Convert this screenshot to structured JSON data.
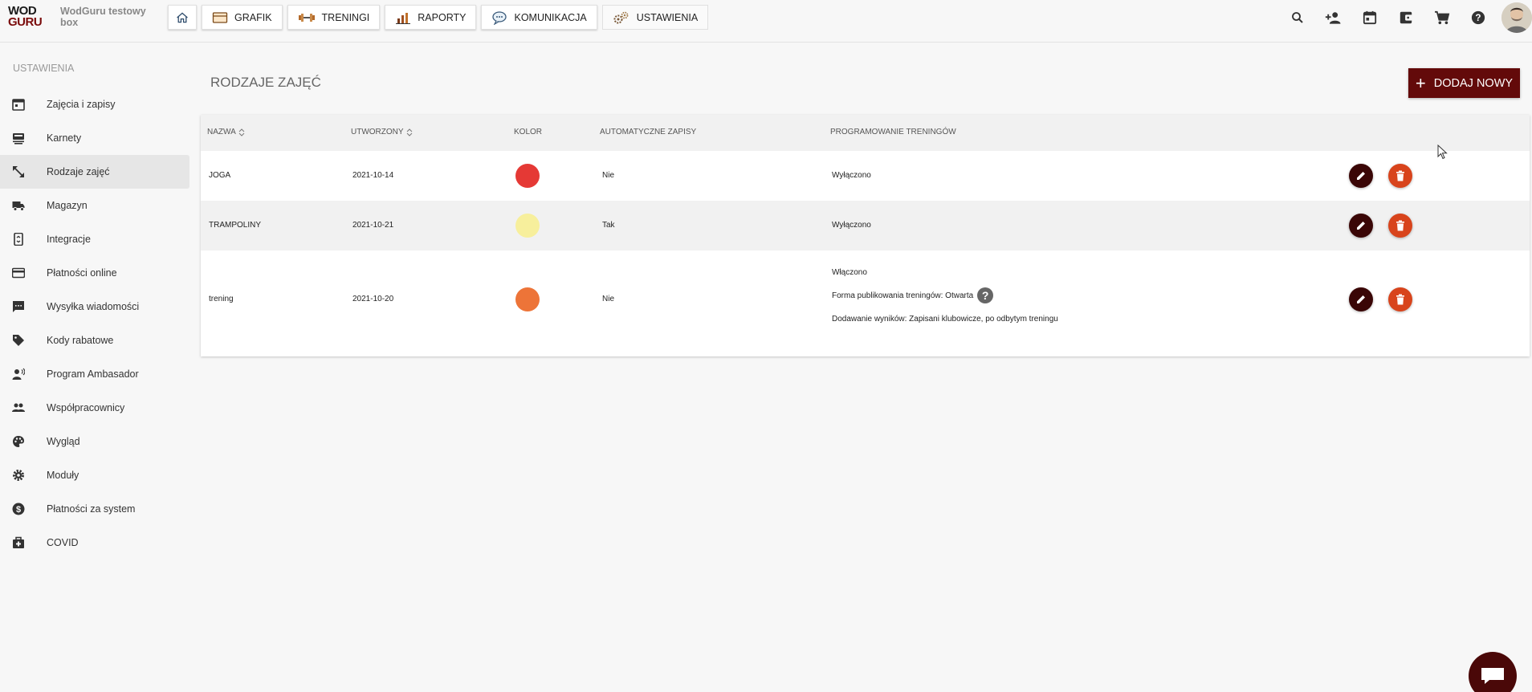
{
  "brand": {
    "logo_line1": "WOD",
    "logo_line2": "GURU",
    "box_name": "WodGuru testowy box"
  },
  "nav": {
    "home_icon": "home-icon",
    "items": [
      {
        "label": "GRAFIK",
        "icon": "schedule-icon"
      },
      {
        "label": "TRENINGI",
        "icon": "dumbbell-icon"
      },
      {
        "label": "RAPORTY",
        "icon": "chart-icon"
      },
      {
        "label": "KOMUNIKACJA",
        "icon": "speech-bubble-icon"
      },
      {
        "label": "USTAWIENIA",
        "icon": "gears-icon"
      }
    ]
  },
  "top_icons": [
    "search-icon",
    "add-person-icon",
    "calendar-icon",
    "wallet-icon",
    "cart-icon",
    "help-icon"
  ],
  "sidebar": {
    "title": "USTAWIENIA",
    "items": [
      {
        "label": "Zajęcia i zapisy",
        "icon": "calendar-icon"
      },
      {
        "label": "Karnety",
        "icon": "card-terminal-icon"
      },
      {
        "label": "Rodzaje zajęć",
        "icon": "resize-arrow-icon",
        "active": true
      },
      {
        "label": "Magazyn",
        "icon": "truck-icon"
      },
      {
        "label": "Integracje",
        "icon": "phone-sync-icon"
      },
      {
        "label": "Płatności online",
        "icon": "credit-card-icon"
      },
      {
        "label": "Wysyłka wiadomości",
        "icon": "message-icon"
      },
      {
        "label": "Kody rabatowe",
        "icon": "tag-icon"
      },
      {
        "label": "Program Ambasador",
        "icon": "voice-person-icon"
      },
      {
        "label": "Współpracownicy",
        "icon": "people-icon"
      },
      {
        "label": "Wygląd",
        "icon": "palette-icon"
      },
      {
        "label": "Moduły",
        "icon": "gear-icon"
      },
      {
        "label": "Płatności za system",
        "icon": "dollar-icon"
      },
      {
        "label": "COVID",
        "icon": "medical-kit-icon"
      }
    ]
  },
  "page": {
    "title": "RODZAJE ZAJĘĆ",
    "add_label": "DODAJ NOWY"
  },
  "table": {
    "headers": {
      "name": "NAZWA",
      "created": "UTWORZONY",
      "color": "KOLOR",
      "auto": "AUTOMATYCZNE ZAPISY",
      "programming": "PROGRAMOWANIE TRENINGÓW"
    },
    "rows": [
      {
        "name": "JOGA",
        "created": "2021-10-14",
        "color": "#e53935",
        "auto": "Nie",
        "programming": [
          "Wyłączono"
        ]
      },
      {
        "name": "TRAMPOLINY",
        "created": "2021-10-21",
        "color": "#f7ef9c",
        "auto": "Tak",
        "programming": [
          "Wyłączono"
        ]
      },
      {
        "name": "trening",
        "created": "2021-10-20",
        "color": "#ed7438",
        "auto": "Nie",
        "programming": [
          "Włączono",
          "Forma publikowania treningów: Otwarta",
          "Dodawanie wyników: Zapisani klubowicze, po odbytym treningu"
        ]
      }
    ]
  }
}
